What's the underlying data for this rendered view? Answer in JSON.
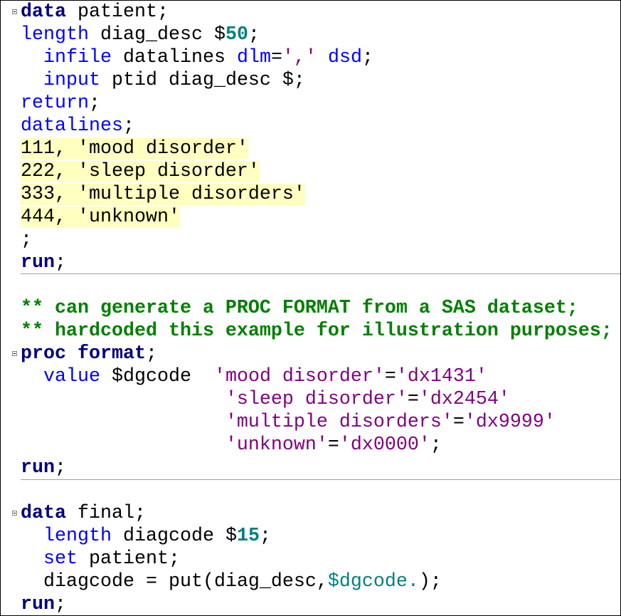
{
  "code": {
    "block1": {
      "l1_kw": "data",
      "l1_rest": " patient;",
      "l2_kw": "length",
      "l2_rest": " diag_desc $",
      "l2_num": "50",
      "l2_end": ";",
      "l3_kw": "infile",
      "l3_rest": " datalines ",
      "l3_kw2": "dlm",
      "l3_eq": "=",
      "l3_str": "','",
      "l3_sp": " ",
      "l3_kw3": "dsd",
      "l3_end": ";",
      "l4_kw": "input",
      "l4_rest": " ptid diag_desc $;",
      "l5_kw": "return",
      "l5_end": ";",
      "l6_kw": "datalines",
      "l6_end": ";",
      "datalines": [
        "111, 'mood disorder'",
        "222, 'sleep disorder'",
        "333, 'multiple disorders'",
        "444, 'unknown'"
      ],
      "l11": ";",
      "l12_kw": "run",
      "l12_end": ";"
    },
    "block2": {
      "comment1": "** can generate a PROC FORMAT from a SAS dataset;",
      "comment2": "** hardcoded this example for illustration purposes;",
      "proc_kw": "proc format",
      "proc_end": ";",
      "value_kw": "value",
      "value_name": " $dgcode  ",
      "map": [
        {
          "from": "'mood disorder'",
          "eq": "=",
          "to": "'dx1431'",
          "end": ""
        },
        {
          "from": "'sleep disorder'",
          "eq": "=",
          "to": "'dx2454'",
          "end": ""
        },
        {
          "from": "'multiple disorders'",
          "eq": "=",
          "to": "'dx9999'",
          "end": ""
        },
        {
          "from": "'unknown'",
          "eq": "=",
          "to": "'dx0000'",
          "end": ";"
        }
      ],
      "run_kw": "run",
      "run_end": ";"
    },
    "block3": {
      "data_kw": "data",
      "data_rest": " final;",
      "len_kw": "length",
      "len_rest": " diagcode $",
      "len_num": "15",
      "len_end": ";",
      "set_kw": "set",
      "set_rest": " patient;",
      "assign_pre": "diagcode = put(diag_desc,",
      "assign_fmt": "$dgcode.",
      "assign_end": ");",
      "run_kw": "run",
      "run_end": ";"
    }
  },
  "colors": {
    "keyword_bold": "#000080",
    "keyword": "#0000ff",
    "string": "#800080",
    "number": "#008080",
    "comment": "#008000",
    "datalines_highlight": "#ffffc0",
    "separator": "#a0a0a0"
  },
  "icons": [
    "fold-collapse-icon"
  ]
}
